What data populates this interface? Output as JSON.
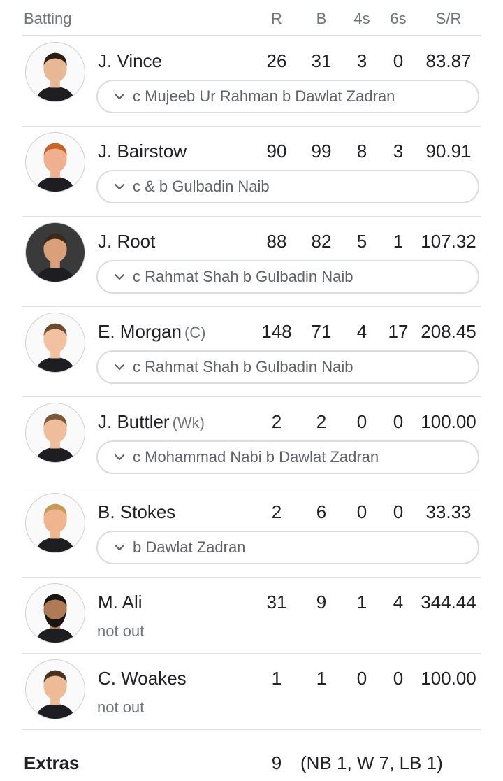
{
  "header": {
    "batting": "Batting",
    "columns": {
      "r": "R",
      "b": "B",
      "fours": "4s",
      "sixes": "6s",
      "sr": "S/R"
    }
  },
  "players": [
    {
      "name": "J. Vince",
      "tag": "",
      "r": "26",
      "b": "31",
      "fours": "3",
      "sixes": "0",
      "sr": "83.87",
      "dismissal": "c Mujeeb Ur Rahman b Dawlat Zadran",
      "out": true
    },
    {
      "name": "J. Bairstow",
      "tag": "",
      "r": "90",
      "b": "99",
      "fours": "8",
      "sixes": "3",
      "sr": "90.91",
      "dismissal": "c & b Gulbadin Naib",
      "out": true
    },
    {
      "name": "J. Root",
      "tag": "",
      "r": "88",
      "b": "82",
      "fours": "5",
      "sixes": "1",
      "sr": "107.32",
      "dismissal": "c Rahmat Shah b Gulbadin Naib",
      "out": true
    },
    {
      "name": "E. Morgan",
      "tag": "(C)",
      "r": "148",
      "b": "71",
      "fours": "4",
      "sixes": "17",
      "sr": "208.45",
      "dismissal": "c Rahmat Shah b Gulbadin Naib",
      "out": true
    },
    {
      "name": "J. Buttler",
      "tag": "(Wk)",
      "r": "2",
      "b": "2",
      "fours": "0",
      "sixes": "0",
      "sr": "100.00",
      "dismissal": "c Mohammad Nabi b Dawlat Zadran",
      "out": true
    },
    {
      "name": "B. Stokes",
      "tag": "",
      "r": "2",
      "b": "6",
      "fours": "0",
      "sixes": "0",
      "sr": "33.33",
      "dismissal": "b Dawlat Zadran",
      "out": true
    },
    {
      "name": "M. Ali",
      "tag": "",
      "r": "31",
      "b": "9",
      "fours": "1",
      "sixes": "4",
      "sr": "344.44",
      "dismissal": "not out",
      "out": false
    },
    {
      "name": "C. Woakes",
      "tag": "",
      "r": "1",
      "b": "1",
      "fours": "0",
      "sixes": "0",
      "sr": "100.00",
      "dismissal": "not out",
      "out": false
    }
  ],
  "extras": {
    "label": "Extras",
    "total": "9",
    "detail": "(NB 1, W 7, LB 1)"
  },
  "icons": {
    "expand": "chevron-down-icon",
    "avatar": "player-photo"
  },
  "colors": {
    "divider": "#e0e0e0",
    "muted": "#70757a",
    "pill_border": "#dadce0"
  }
}
